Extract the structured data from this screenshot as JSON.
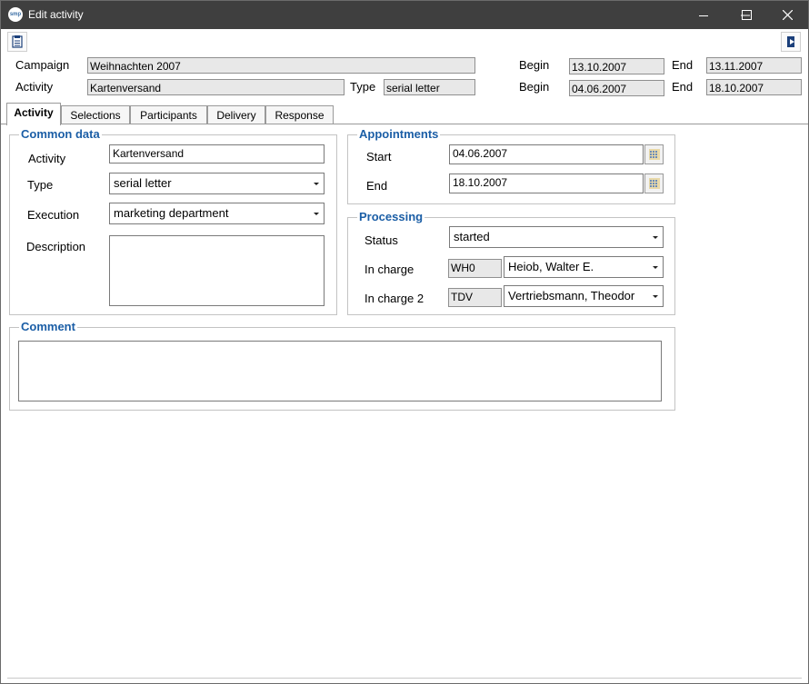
{
  "window": {
    "app_logo_text": "smp",
    "title": "Edit activity",
    "minimize_icon": "minimize-icon",
    "maximize_icon": "maximize-icon",
    "close_icon": "close-icon"
  },
  "toolbar": {
    "left_icon": "document-icon",
    "right_icon": "exit-icon"
  },
  "header": {
    "campaign_label": "Campaign",
    "campaign_value": "Weihnachten 2007",
    "campaign_begin_label": "Begin",
    "campaign_begin_value": "13.10.2007",
    "campaign_end_label": "End",
    "campaign_end_value": "13.11.2007",
    "activity_label": "Activity",
    "activity_value": "Kartenversand",
    "type_label": "Type",
    "type_value": "serial letter",
    "activity_begin_label": "Begin",
    "activity_begin_value": "04.06.2007",
    "activity_end_label": "End",
    "activity_end_value": "18.10.2007"
  },
  "tabs": [
    {
      "label": "Activity",
      "active": true
    },
    {
      "label": "Selections",
      "active": false
    },
    {
      "label": "Participants",
      "active": false
    },
    {
      "label": "Delivery",
      "active": false
    },
    {
      "label": "Response",
      "active": false
    }
  ],
  "common_data": {
    "title": "Common data",
    "activity_label": "Activity",
    "activity_value": "Kartenversand",
    "type_label": "Type",
    "type_value": "serial letter",
    "execution_label": "Execution",
    "execution_value": "marketing department",
    "description_label": "Description",
    "description_value": ""
  },
  "appointments": {
    "title": "Appointments",
    "start_label": "Start",
    "start_value": "04.06.2007",
    "end_label": "End",
    "end_value": "18.10.2007",
    "calendar_icon": "calendar-icon"
  },
  "processing": {
    "title": "Processing",
    "status_label": "Status",
    "status_value": "started",
    "in_charge_label": "In charge",
    "in_charge_code": "WH0",
    "in_charge_name": "Heiob, Walter E.",
    "in_charge2_label": "In charge 2",
    "in_charge2_code": "TDV",
    "in_charge2_name": "Vertriebsmann, Theodor"
  },
  "comment": {
    "title": "Comment",
    "value": ""
  },
  "colors": {
    "titlebar": "#3f3f3f",
    "group_title": "#1b5ea6",
    "readonly_field": "#e8e8e8"
  }
}
